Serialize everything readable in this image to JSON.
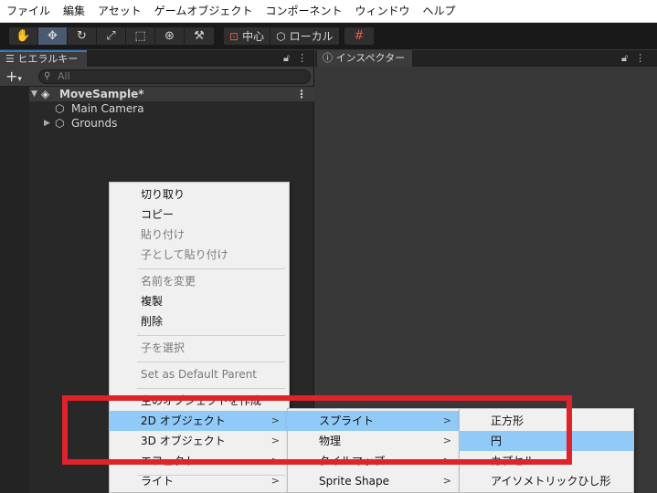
{
  "menubar": [
    "ファイル",
    "編集",
    "アセット",
    "ゲームオブジェクト",
    "コンポーネント",
    "ウィンドウ",
    "ヘルプ"
  ],
  "toolbar": {
    "tools": [
      "hand-icon",
      "move-icon",
      "rotate-icon",
      "scale-icon",
      "rect-icon",
      "transform-icon",
      "custom-tool-icon"
    ],
    "pivot_label": "中心",
    "space_label": "ローカル"
  },
  "hierarchy": {
    "tab_label": "ヒエラルキー",
    "search_placeholder": "All",
    "scene": "MoveSample*",
    "items": [
      "Main Camera",
      "Grounds"
    ]
  },
  "inspector": {
    "tab_label": "インスペクター"
  },
  "context_menu": {
    "items": [
      {
        "label": "切り取り",
        "disabled": false
      },
      {
        "label": "コピー",
        "disabled": false
      },
      {
        "label": "貼り付け",
        "disabled": true
      },
      {
        "label": "子として貼り付け",
        "disabled": true
      },
      {
        "label": "名前を変更",
        "disabled": true
      },
      {
        "label": "複製",
        "disabled": false
      },
      {
        "label": "削除",
        "disabled": false
      },
      {
        "label": "子を選択",
        "disabled": true
      },
      {
        "label": "Set as Default Parent",
        "disabled": true
      },
      {
        "label": "空のオブジェクトを作成",
        "disabled": false
      },
      {
        "label": "2D オブジェクト",
        "disabled": false
      },
      {
        "label": "3D オブジェクト",
        "disabled": false
      },
      {
        "label": "エフェクト",
        "disabled": false
      },
      {
        "label": "ライト",
        "disabled": false
      }
    ]
  },
  "submenu_2d": {
    "items": [
      "スプライト",
      "物理",
      "タイルマップ",
      "Sprite Shape"
    ]
  },
  "submenu_sprite": {
    "items": [
      "正方形",
      "円",
      "カプセル",
      "アイソメトリックひし形"
    ]
  },
  "colors": {
    "highlight": "#91c9f7",
    "annotation_box": "#e0222a"
  }
}
